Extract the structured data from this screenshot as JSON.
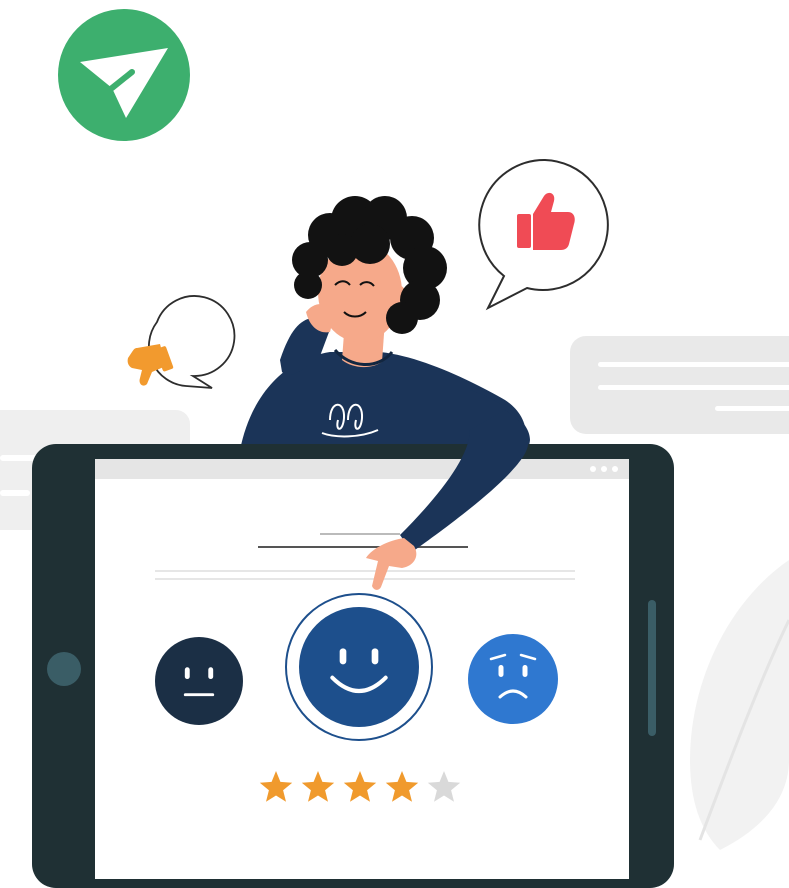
{
  "brand": {
    "logo_icon": "paper-plane-check-icon",
    "logo_color": "#3daf6e"
  },
  "feedback_bubbles": {
    "like_icon": "thumbs-up-icon",
    "like_color": "#f04b55",
    "dislike_icon": "thumbs-down-icon",
    "dislike_color": "#f29a2e"
  },
  "rating_screen": {
    "faces": [
      {
        "icon": "neutral-face-icon",
        "mood": "neutral",
        "color": "#1b2f45"
      },
      {
        "icon": "happy-face-icon",
        "mood": "happy",
        "color": "#1d4f8c",
        "selected": true
      },
      {
        "icon": "sad-face-icon",
        "mood": "sad",
        "color": "#2f78d0"
      }
    ],
    "stars": {
      "icon": "star-icon",
      "total": 5,
      "filled": 4,
      "filled_color": "#f09a2d",
      "empty_color": "#d9d9d9"
    }
  },
  "colors": {
    "tablet_frame": "#1f3034",
    "screen": "#ffffff",
    "sweater": "#1b3458",
    "skin": "#f6a98a",
    "hair": "#121212",
    "panel_gray": "#e6e6e6"
  }
}
